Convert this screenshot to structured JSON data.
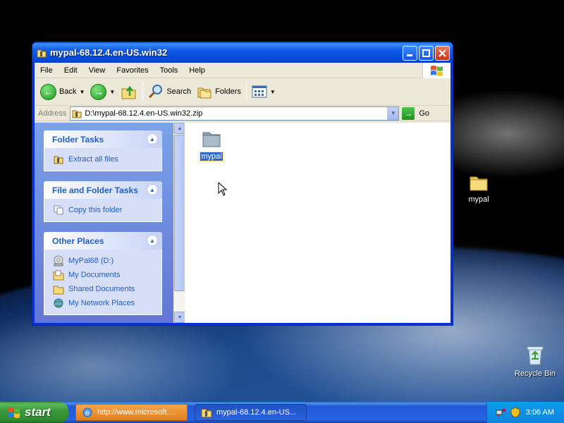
{
  "desktop": {
    "icons": [
      {
        "label": "mypal",
        "icon": "folder-icon"
      },
      {
        "label": "Recycle Bin",
        "icon": "recycle-bin-icon"
      }
    ]
  },
  "window": {
    "title": "mypal-68.12.4.en-US.win32",
    "menu": [
      "File",
      "Edit",
      "View",
      "Favorites",
      "Tools",
      "Help"
    ],
    "toolbar": {
      "back": "Back",
      "search": "Search",
      "folders": "Folders"
    },
    "address": {
      "label": "Address",
      "value": "D:\\mypal-68.12.4.en-US.win32.zip",
      "go": "Go"
    },
    "taskpane": {
      "panels": [
        {
          "title": "Folder Tasks",
          "items": [
            {
              "label": "Extract all files",
              "icon": "extract-icon"
            }
          ]
        },
        {
          "title": "File and Folder Tasks",
          "items": [
            {
              "label": "Copy this folder",
              "icon": "copy-icon"
            }
          ]
        },
        {
          "title": "Other Places",
          "items": [
            {
              "label": "MyPal68 (D:)",
              "icon": "drive-icon"
            },
            {
              "label": "My Documents",
              "icon": "my-documents-icon"
            },
            {
              "label": "Shared Documents",
              "icon": "shared-documents-icon"
            },
            {
              "label": "My Network Places",
              "icon": "network-places-icon"
            }
          ]
        }
      ]
    },
    "files": [
      {
        "name": "mypal",
        "type": "folder",
        "selected": true
      }
    ]
  },
  "taskbar": {
    "start": "start",
    "tasks": [
      {
        "label": "http://www.microsoft....",
        "icon": "ie-icon"
      },
      {
        "label": "mypal-68.12.4.en-US...",
        "icon": "zip-folder-icon"
      }
    ],
    "clock": "3:06 AM"
  },
  "colors": {
    "titlebar": "#0a5be8",
    "taskpane_link": "#215dc6",
    "selection": "#316ac5",
    "start_button": "#3a9a3a"
  }
}
